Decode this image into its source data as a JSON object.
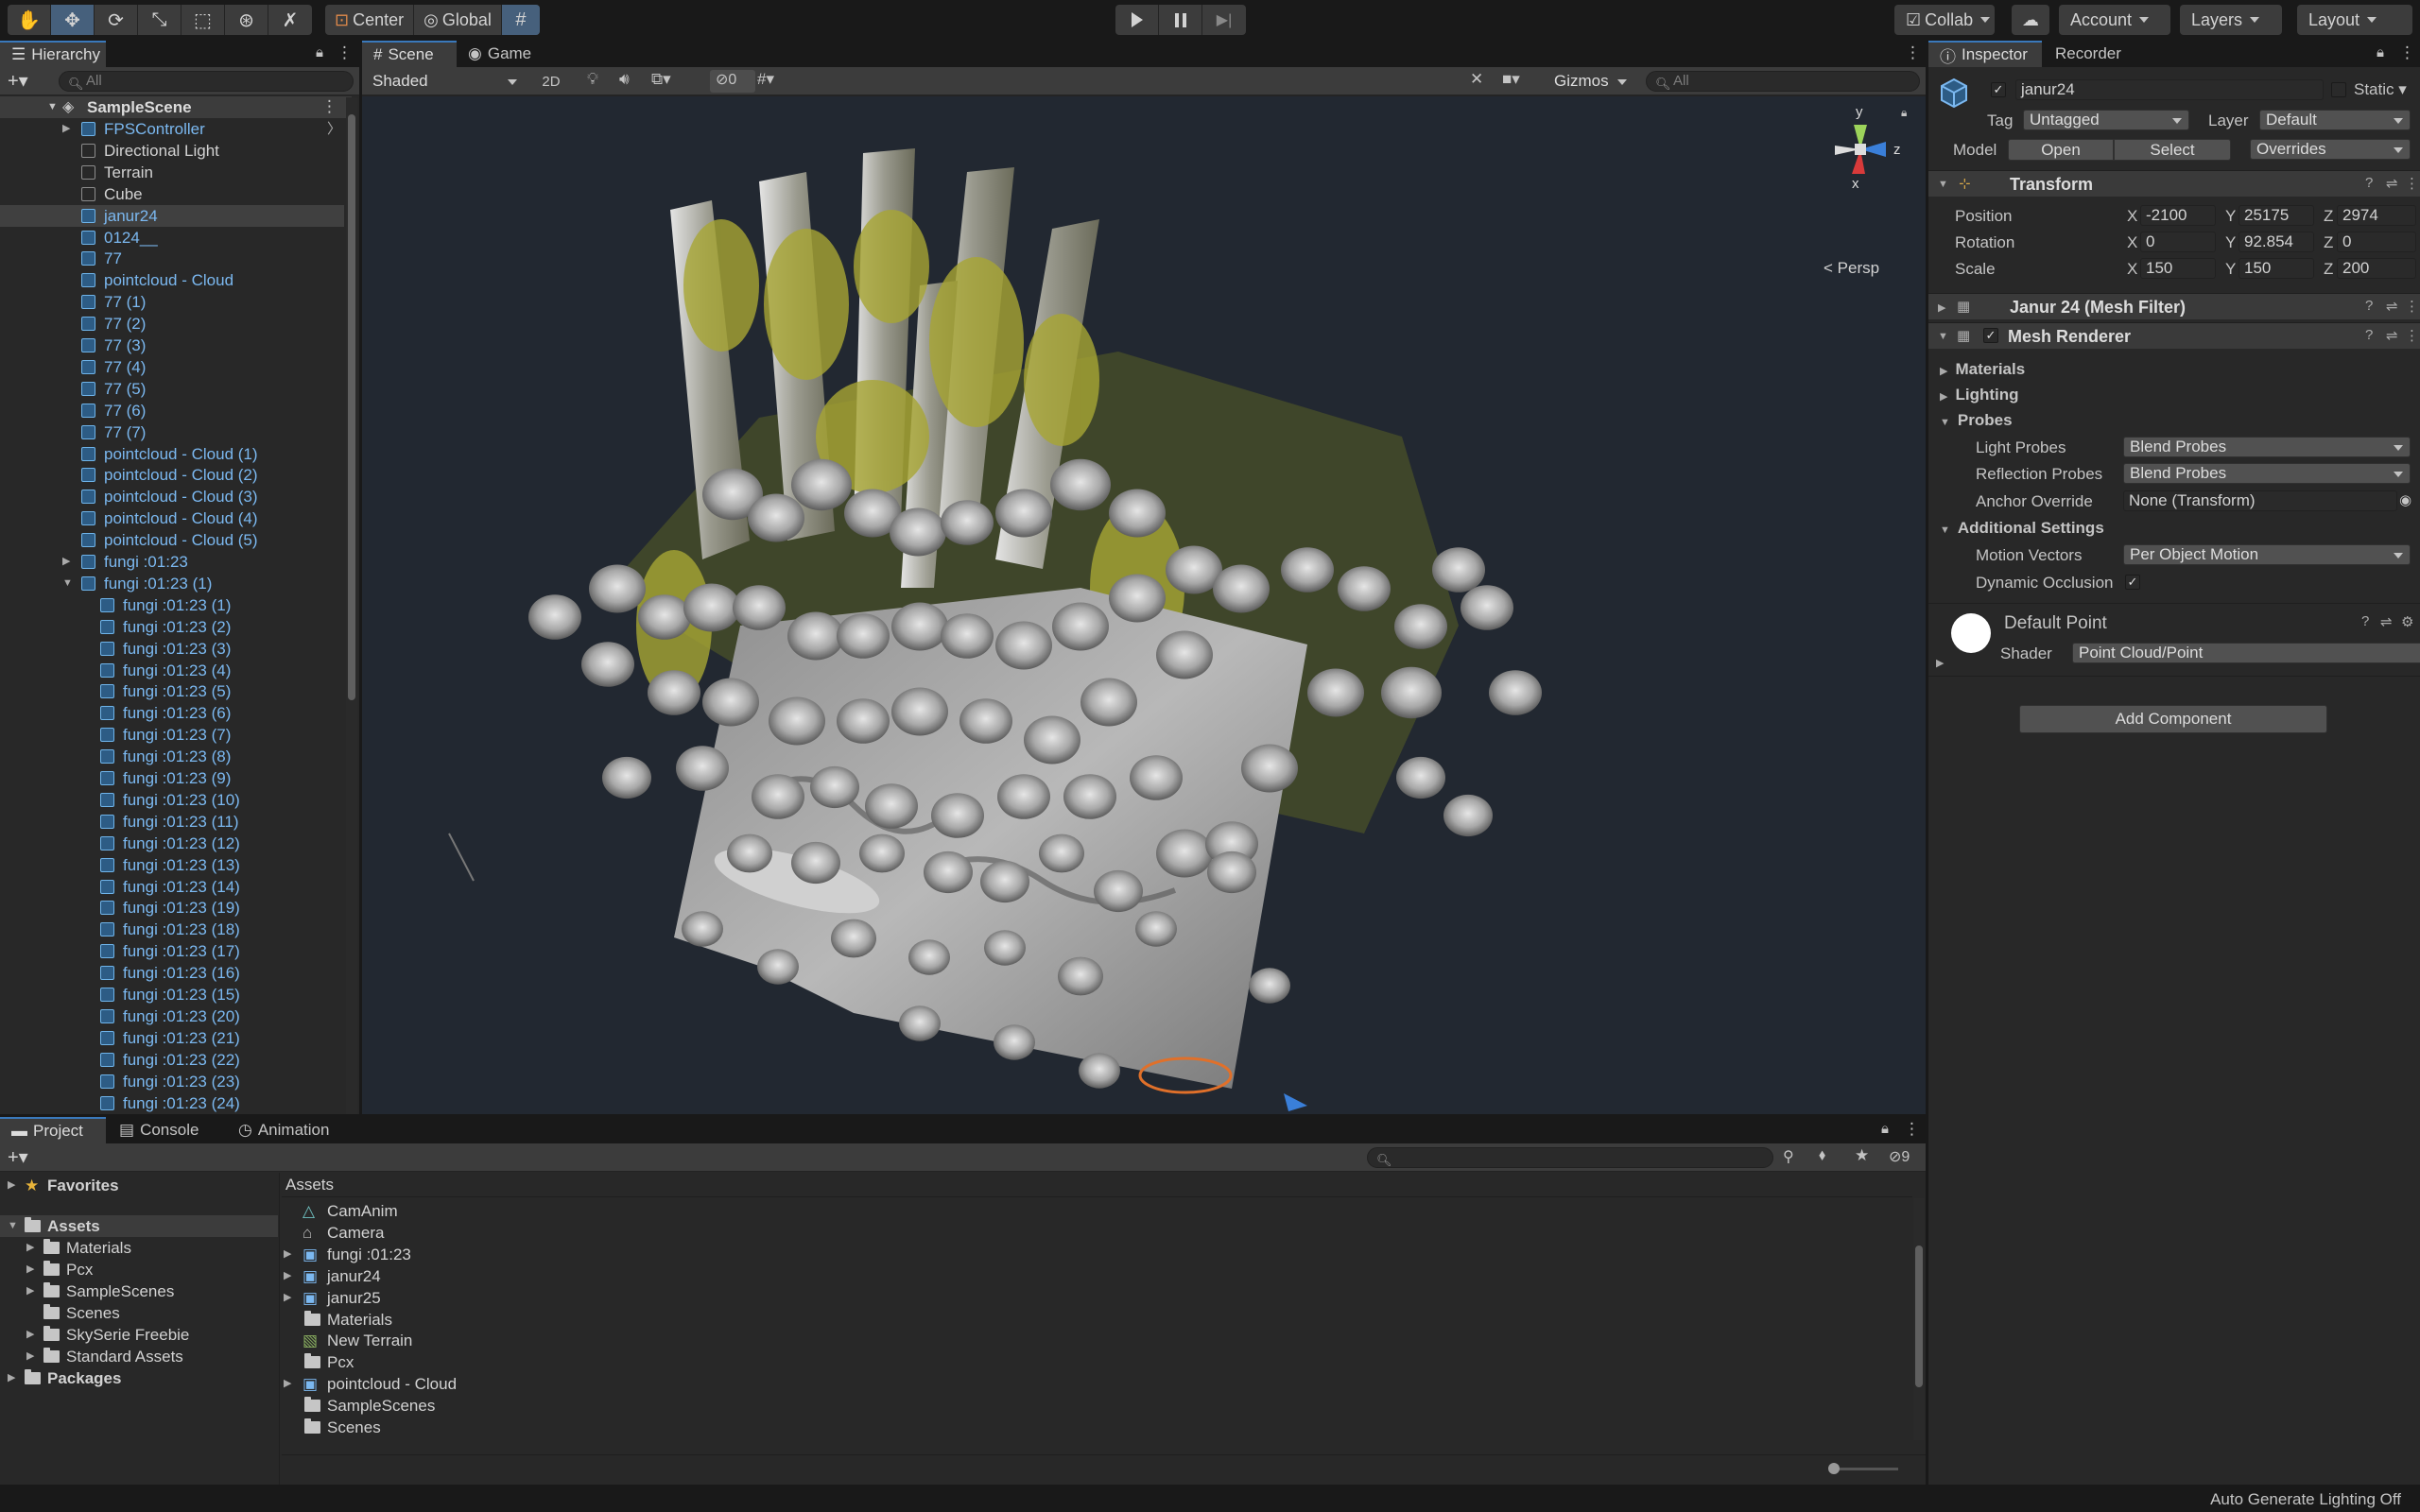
{
  "toolbar": {
    "tools": [
      "hand-tool",
      "move-tool",
      "rotate-tool",
      "scale-tool",
      "rect-tool",
      "transform-tool",
      "custom-tool"
    ],
    "pivot_mode": "Center",
    "pivot_rotation": "Global",
    "collab_label": "Collab",
    "account_label": "Account",
    "layers_label": "Layers",
    "layout_label": "Layout"
  },
  "hierarchy": {
    "tab_label": "Hierarchy",
    "search_placeholder": "All",
    "scene_name": "SampleScene",
    "items": [
      {
        "label": "FPSController",
        "type": "prefab",
        "depth": 1,
        "arrow": "right"
      },
      {
        "label": "Directional Light",
        "type": "object",
        "depth": 1,
        "arrow": ""
      },
      {
        "label": "Terrain",
        "type": "object",
        "depth": 1,
        "arrow": ""
      },
      {
        "label": "Cube",
        "type": "object",
        "depth": 1,
        "arrow": ""
      },
      {
        "label": "janur24",
        "type": "prefab-selected",
        "depth": 1,
        "arrow": ""
      },
      {
        "label": "0124__",
        "type": "prefab",
        "depth": 1,
        "arrow": ""
      },
      {
        "label": "77",
        "type": "prefab",
        "depth": 1,
        "arrow": ""
      },
      {
        "label": "pointcloud - Cloud",
        "type": "prefab",
        "depth": 1,
        "arrow": ""
      },
      {
        "label": "77 (1)",
        "type": "prefab",
        "depth": 1,
        "arrow": ""
      },
      {
        "label": "77 (2)",
        "type": "prefab",
        "depth": 1,
        "arrow": ""
      },
      {
        "label": "77 (3)",
        "type": "prefab",
        "depth": 1,
        "arrow": ""
      },
      {
        "label": "77 (4)",
        "type": "prefab",
        "depth": 1,
        "arrow": ""
      },
      {
        "label": "77 (5)",
        "type": "prefab",
        "depth": 1,
        "arrow": ""
      },
      {
        "label": "77 (6)",
        "type": "prefab",
        "depth": 1,
        "arrow": ""
      },
      {
        "label": "77 (7)",
        "type": "prefab",
        "depth": 1,
        "arrow": ""
      },
      {
        "label": "pointcloud - Cloud (1)",
        "type": "prefab",
        "depth": 1,
        "arrow": ""
      },
      {
        "label": "pointcloud - Cloud (2)",
        "type": "prefab",
        "depth": 1,
        "arrow": ""
      },
      {
        "label": "pointcloud - Cloud (3)",
        "type": "prefab",
        "depth": 1,
        "arrow": ""
      },
      {
        "label": "pointcloud - Cloud (4)",
        "type": "prefab",
        "depth": 1,
        "arrow": ""
      },
      {
        "label": "pointcloud - Cloud (5)",
        "type": "prefab",
        "depth": 1,
        "arrow": ""
      },
      {
        "label": "fungi :01:23",
        "type": "prefab",
        "depth": 1,
        "arrow": "right"
      },
      {
        "label": "fungi :01:23 (1)",
        "type": "prefab",
        "depth": 1,
        "arrow": "down"
      },
      {
        "label": "fungi :01:23 (1)",
        "type": "prefab",
        "depth": 2,
        "arrow": ""
      },
      {
        "label": "fungi :01:23 (2)",
        "type": "prefab",
        "depth": 2,
        "arrow": ""
      },
      {
        "label": "fungi :01:23 (3)",
        "type": "prefab",
        "depth": 2,
        "arrow": ""
      },
      {
        "label": "fungi :01:23 (4)",
        "type": "prefab",
        "depth": 2,
        "arrow": ""
      },
      {
        "label": "fungi :01:23 (5)",
        "type": "prefab",
        "depth": 2,
        "arrow": ""
      },
      {
        "label": "fungi :01:23 (6)",
        "type": "prefab",
        "depth": 2,
        "arrow": ""
      },
      {
        "label": "fungi :01:23 (7)",
        "type": "prefab",
        "depth": 2,
        "arrow": ""
      },
      {
        "label": "fungi :01:23 (8)",
        "type": "prefab",
        "depth": 2,
        "arrow": ""
      },
      {
        "label": "fungi :01:23 (9)",
        "type": "prefab",
        "depth": 2,
        "arrow": ""
      },
      {
        "label": "fungi :01:23 (10)",
        "type": "prefab",
        "depth": 2,
        "arrow": ""
      },
      {
        "label": "fungi :01:23 (11)",
        "type": "prefab",
        "depth": 2,
        "arrow": ""
      },
      {
        "label": "fungi :01:23 (12)",
        "type": "prefab",
        "depth": 2,
        "arrow": ""
      },
      {
        "label": "fungi :01:23 (13)",
        "type": "prefab",
        "depth": 2,
        "arrow": ""
      },
      {
        "label": "fungi :01:23 (14)",
        "type": "prefab",
        "depth": 2,
        "arrow": ""
      },
      {
        "label": "fungi :01:23 (19)",
        "type": "prefab",
        "depth": 2,
        "arrow": ""
      },
      {
        "label": "fungi :01:23 (18)",
        "type": "prefab",
        "depth": 2,
        "arrow": ""
      },
      {
        "label": "fungi :01:23 (17)",
        "type": "prefab",
        "depth": 2,
        "arrow": ""
      },
      {
        "label": "fungi :01:23 (16)",
        "type": "prefab",
        "depth": 2,
        "arrow": ""
      },
      {
        "label": "fungi :01:23 (15)",
        "type": "prefab",
        "depth": 2,
        "arrow": ""
      },
      {
        "label": "fungi :01:23 (20)",
        "type": "prefab",
        "depth": 2,
        "arrow": ""
      },
      {
        "label": "fungi :01:23 (21)",
        "type": "prefab",
        "depth": 2,
        "arrow": ""
      },
      {
        "label": "fungi :01:23 (22)",
        "type": "prefab",
        "depth": 2,
        "arrow": ""
      },
      {
        "label": "fungi :01:23 (23)",
        "type": "prefab",
        "depth": 2,
        "arrow": ""
      },
      {
        "label": "fungi :01:23 (24)",
        "type": "prefab",
        "depth": 2,
        "arrow": ""
      }
    ]
  },
  "scene": {
    "tabs": [
      "Scene",
      "Game"
    ],
    "draw_mode": "Shaded",
    "mode_2d": "2D",
    "hidden_count": "0",
    "gizmos_label": "Gizmos",
    "search_placeholder": "All",
    "persp_label": "< Persp",
    "axis_y": "y",
    "axis_z": "z",
    "axis_x": "x"
  },
  "inspector": {
    "tabs": [
      "Inspector",
      "Recorder"
    ],
    "object_name": "janur24",
    "static_label": "Static",
    "tag_label": "Tag",
    "tag_value": "Untagged",
    "layer_label": "Layer",
    "layer_value": "Default",
    "model_label": "Model",
    "open_label": "Open",
    "select_label": "Select",
    "overrides_label": "Overrides",
    "transform": {
      "title": "Transform",
      "position_label": "Position",
      "rotation_label": "Rotation",
      "scale_label": "Scale",
      "position": {
        "x": "-2100",
        "y": "25175",
        "z": "2974"
      },
      "rotation": {
        "x": "0",
        "y": "92.854",
        "z": "0"
      },
      "scale": {
        "x": "150",
        "y": "150",
        "z": "200"
      },
      "axis_labels": [
        "X",
        "Y",
        "Z"
      ]
    },
    "mesh_filter_title": "Janur 24 (Mesh Filter)",
    "mesh_renderer_title": "Mesh Renderer",
    "materials_label": "Materials",
    "lighting_label": "Lighting",
    "probes_label": "Probes",
    "light_probes_label": "Light Probes",
    "light_probes_value": "Blend Probes",
    "reflection_probes_label": "Reflection Probes",
    "reflection_probes_value": "Blend Probes",
    "anchor_override_label": "Anchor Override",
    "anchor_override_value": "None (Transform)",
    "additional_settings_label": "Additional Settings",
    "motion_vectors_label": "Motion Vectors",
    "motion_vectors_value": "Per Object Motion",
    "dynamic_occlusion_label": "Dynamic Occlusion",
    "material_name": "Default Point",
    "shader_label": "Shader",
    "shader_value": "Point Cloud/Point",
    "add_component_label": "Add Component"
  },
  "project": {
    "tabs": [
      "Project",
      "Console",
      "Animation"
    ],
    "hidden_count": "9",
    "tree": [
      {
        "label": "Favorites",
        "depth": 0,
        "icon": "star",
        "bold": true,
        "arrow": "right"
      },
      {
        "label": "Assets",
        "depth": 0,
        "icon": "folder",
        "bold": true,
        "arrow": "down",
        "selected": true
      },
      {
        "label": "Materials",
        "depth": 1,
        "icon": "folder",
        "arrow": "right"
      },
      {
        "label": "Pcx",
        "depth": 1,
        "icon": "folder",
        "arrow": "right"
      },
      {
        "label": "SampleScenes",
        "depth": 1,
        "icon": "folder",
        "arrow": "right"
      },
      {
        "label": "Scenes",
        "depth": 1,
        "icon": "folder",
        "arrow": ""
      },
      {
        "label": "SkySerie Freebie",
        "depth": 1,
        "icon": "folder",
        "arrow": "right"
      },
      {
        "label": "Standard Assets",
        "depth": 1,
        "icon": "folder",
        "arrow": "right"
      },
      {
        "label": "Packages",
        "depth": 0,
        "icon": "folder",
        "bold": true,
        "arrow": "right"
      }
    ],
    "assets_header": "Assets",
    "assets": [
      {
        "label": "CamAnim",
        "icon": "anim",
        "arrow": ""
      },
      {
        "label": "Camera",
        "icon": "camera",
        "arrow": ""
      },
      {
        "label": "fungi :01:23",
        "icon": "prefab",
        "arrow": "right"
      },
      {
        "label": "janur24",
        "icon": "prefab",
        "arrow": "right"
      },
      {
        "label": "janur25",
        "icon": "prefab",
        "arrow": "right"
      },
      {
        "label": "Materials",
        "icon": "folder",
        "arrow": ""
      },
      {
        "label": "New Terrain",
        "icon": "terrain",
        "arrow": ""
      },
      {
        "label": "Pcx",
        "icon": "folder",
        "arrow": ""
      },
      {
        "label": "pointcloud - Cloud",
        "icon": "prefab",
        "arrow": "right"
      },
      {
        "label": "SampleScenes",
        "icon": "folder",
        "arrow": ""
      },
      {
        "label": "Scenes",
        "icon": "folder",
        "arrow": ""
      }
    ]
  },
  "status_bar": {
    "message": "Auto Generate Lighting Off"
  }
}
